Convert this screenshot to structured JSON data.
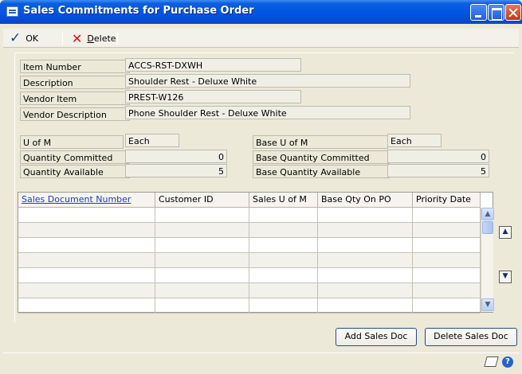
{
  "window": {
    "title": "Sales Commitments for Purchase Order"
  },
  "toolbar": {
    "ok_label": "OK",
    "delete_label": "Delete"
  },
  "fields": {
    "item_number": {
      "label": "Item Number",
      "value": "ACCS-RST-DXWH"
    },
    "description": {
      "label": "Description",
      "value": "Shoulder Rest - Deluxe White"
    },
    "vendor_item": {
      "label": "Vendor Item",
      "value": "PREST-W126"
    },
    "vendor_description": {
      "label": "Vendor Description",
      "value": "Phone Shoulder Rest - Deluxe White"
    }
  },
  "quantities": {
    "u_of_m": {
      "label": "U of M",
      "value": "Each"
    },
    "qty_committed": {
      "label": "Quantity Committed",
      "value": "0"
    },
    "qty_available": {
      "label": "Quantity Available",
      "value": "5"
    },
    "base_u_of_m": {
      "label": "Base U of M",
      "value": "Each"
    },
    "base_qty_committed": {
      "label": "Base Quantity Committed",
      "value": "0"
    },
    "base_qty_available": {
      "label": "Base Quantity Available",
      "value": "5"
    }
  },
  "grid": {
    "columns": [
      "Sales Document Number",
      "Customer ID",
      "Sales U of M",
      "Base Qty On PO",
      "Priority Date"
    ],
    "row_count": 7
  },
  "buttons": {
    "add_sales_doc": "Add Sales Doc",
    "delete_sales_doc": "Delete Sales Doc"
  },
  "icons": {
    "ok": "check-icon",
    "delete": "x-icon",
    "window": "window-icon",
    "prev": "expand-up-icon",
    "next": "expand-down-icon",
    "note": "note-icon",
    "help": "help-icon"
  },
  "colors": {
    "title_bar": "#0054e3",
    "link": "#1a3fc8",
    "window_bg": "#ece9d8"
  }
}
